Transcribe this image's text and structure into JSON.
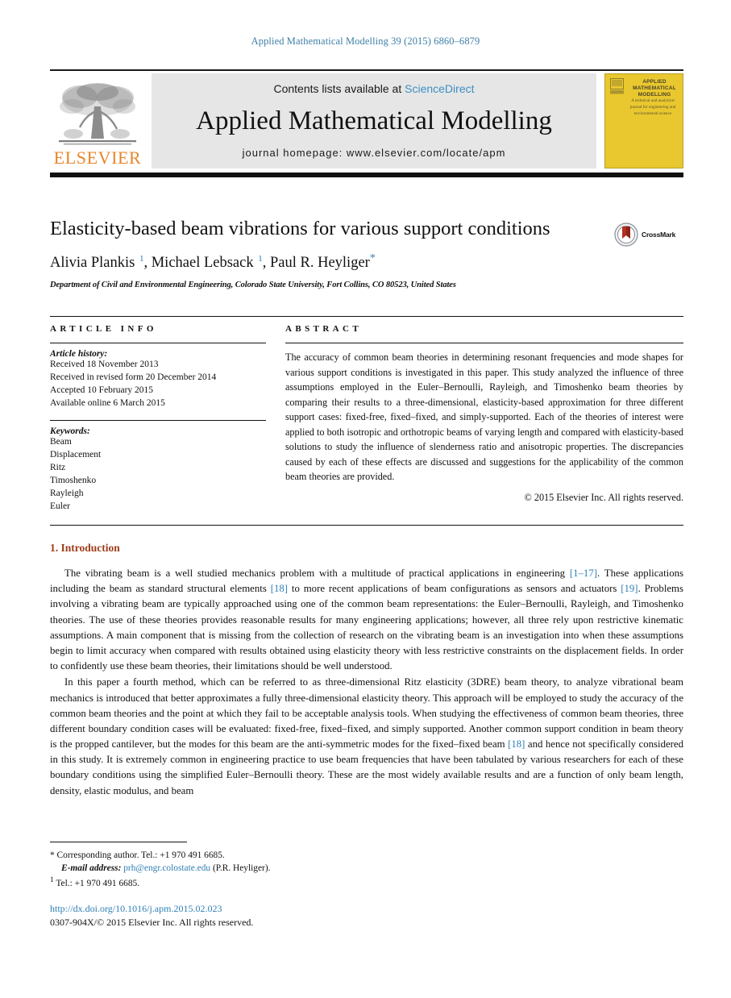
{
  "running_head": "Applied Mathematical Modelling 39 (2015) 6860–6879",
  "masthead": {
    "contents_prefix": "Contents lists available at ",
    "sciencedirect": "ScienceDirect",
    "journal_name": "Applied Mathematical Modelling",
    "homepage": "journal homepage: www.elsevier.com/locate/apm",
    "publisher": "ELSEVIER",
    "cover": {
      "title": "APPLIED MATHEMATICAL MODELLING",
      "subtitle": "A technical and analytical journal for engineering and environmental science"
    },
    "accent_orange": "#e8862a",
    "accent_blue": "#3d8fc4",
    "cover_yellow": "#e9c82f"
  },
  "article": {
    "title": "Elasticity-based beam vibrations for various support conditions",
    "crossmark_label": "CrossMark",
    "authors_html": "Alivia Plankis <sup>1</sup>, Michael Lebsack <sup>1</sup>, Paul R. Heyliger<span class=\"star\">*</span>",
    "affiliation": "Department of Civil and Environmental Engineering, Colorado State University, Fort Collins, CO 80523, United States"
  },
  "article_info": {
    "heading": "ARTICLE INFO",
    "history_title": "Article history:",
    "history": [
      "Received 18 November 2013",
      "Received in revised form 20 December 2014",
      "Accepted 10 February 2015",
      "Available online 6 March 2015"
    ],
    "keywords_title": "Keywords:",
    "keywords": [
      "Beam",
      "Displacement",
      "Ritz",
      "Timoshenko",
      "Rayleigh",
      "Euler"
    ]
  },
  "abstract": {
    "heading": "ABSTRACT",
    "text": "The accuracy of common beam theories in determining resonant frequencies and mode shapes for various support conditions is investigated in this paper. This study analyzed the influence of three assumptions employed in the Euler–Bernoulli, Rayleigh, and Timoshenko beam theories by comparing their results to a three-dimensional, elasticity-based approximation for three different support cases: fixed-free, fixed–fixed, and simply-supported. Each of the theories of interest were applied to both isotropic and orthotropic beams of varying length and compared with elasticity-based solutions to study the influence of slenderness ratio and anisotropic properties. The discrepancies caused by each of these effects are discussed and suggestions for the applicability of the common beam theories are provided.",
    "copyright": "© 2015 Elsevier Inc. All rights reserved."
  },
  "body": {
    "section_heading": "1. Introduction",
    "paragraph1_html": "The vibrating beam is a well studied mechanics problem with a multitude of practical applications in engineering <span class=\"ref\">[1–17]</span>. These applications including the beam as standard structural elements <span class=\"ref\">[18]</span> to more recent applications of beam configurations as sensors and actuators <span class=\"ref\">[19]</span>. Problems involving a vibrating beam are typically approached using one of the common beam representations: the Euler–Bernoulli, Rayleigh, and Timoshenko theories. The use of these theories provides reasonable results for many engineering applications; however, all three rely upon restrictive kinematic assumptions. A main component that is missing from the collection of research on the vibrating beam is an investigation into when these assumptions begin to limit accuracy when compared with results obtained using elasticity theory with less restrictive constraints on the displacement fields. In order to confidently use these beam theories, their limitations should be well understood.",
    "paragraph2_html": "In this paper a fourth method, which can be referred to as three-dimensional Ritz elasticity (3DRE) beam theory, to analyze vibrational beam mechanics is introduced that better approximates a fully three-dimensional elasticity theory. This approach will be employed to study the accuracy of the common beam theories and the point at which they fail to be acceptable analysis tools. When studying the effectiveness of common beam theories, three different boundary condition cases will be evaluated: fixed-free, fixed–fixed, and simply supported. Another common support condition in beam theory is the propped cantilever, but the modes for this beam are the anti-symmetric modes for the fixed–fixed beam <span class=\"ref\">[18]</span> and hence not specifically considered in this study. It is extremely common in engineering practice to use beam frequencies that have been tabulated by various researchers for each of these boundary conditions using the simplified Euler–Bernoulli theory. These are the most widely available results and are a function of only beam length, density, elastic modulus, and beam"
  },
  "footnotes": {
    "corresponding_html": "<span class=\"marker\">*</span> Corresponding author. Tel.: +1 970 491 6685.",
    "email_html": "<em>E-mail address:</em> <span class=\"mail\">prh@engr.colostate.edu</span> (P.R. Heyliger).",
    "tel_html": "<sup>1</sup> Tel.: +1 970 491 6685."
  },
  "doi": {
    "link": "http://dx.doi.org/10.1016/j.apm.2015.02.023",
    "issn": "0307-904X/© 2015 Elsevier Inc. All rights reserved."
  }
}
